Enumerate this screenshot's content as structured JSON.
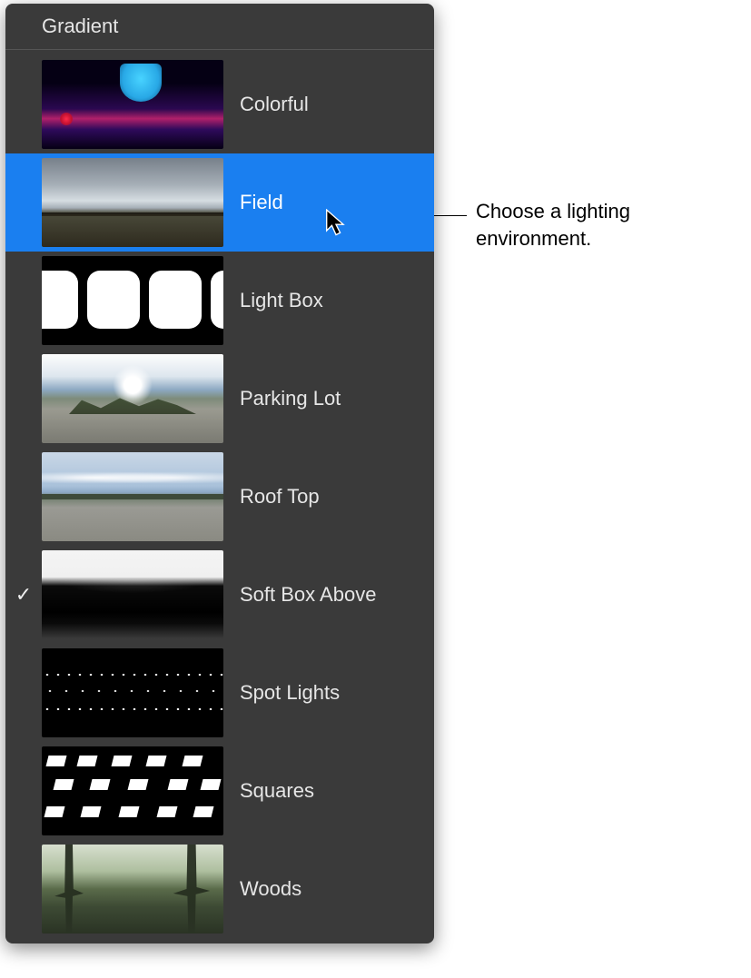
{
  "panel": {
    "title": "Gradient",
    "items": [
      {
        "label": "Colorful",
        "selected": false,
        "checked": false,
        "thumb": "colorful"
      },
      {
        "label": "Field",
        "selected": true,
        "checked": false,
        "thumb": "field"
      },
      {
        "label": "Light Box",
        "selected": false,
        "checked": false,
        "thumb": "lightbox"
      },
      {
        "label": "Parking Lot",
        "selected": false,
        "checked": false,
        "thumb": "parking"
      },
      {
        "label": "Roof Top",
        "selected": false,
        "checked": false,
        "thumb": "roof"
      },
      {
        "label": "Soft Box Above",
        "selected": false,
        "checked": true,
        "thumb": "softbox"
      },
      {
        "label": "Spot Lights",
        "selected": false,
        "checked": false,
        "thumb": "spot"
      },
      {
        "label": "Squares",
        "selected": false,
        "checked": false,
        "thumb": "squares"
      },
      {
        "label": "Woods",
        "selected": false,
        "checked": false,
        "thumb": "woods"
      }
    ]
  },
  "annotation": {
    "text": "Choose a lighting environment."
  },
  "colors": {
    "panel_bg": "#3a3a3a",
    "selection": "#1a7ff0",
    "text": "#e6e6e6"
  },
  "icons": {
    "check": "✓",
    "cursor": "arrow-cursor"
  }
}
